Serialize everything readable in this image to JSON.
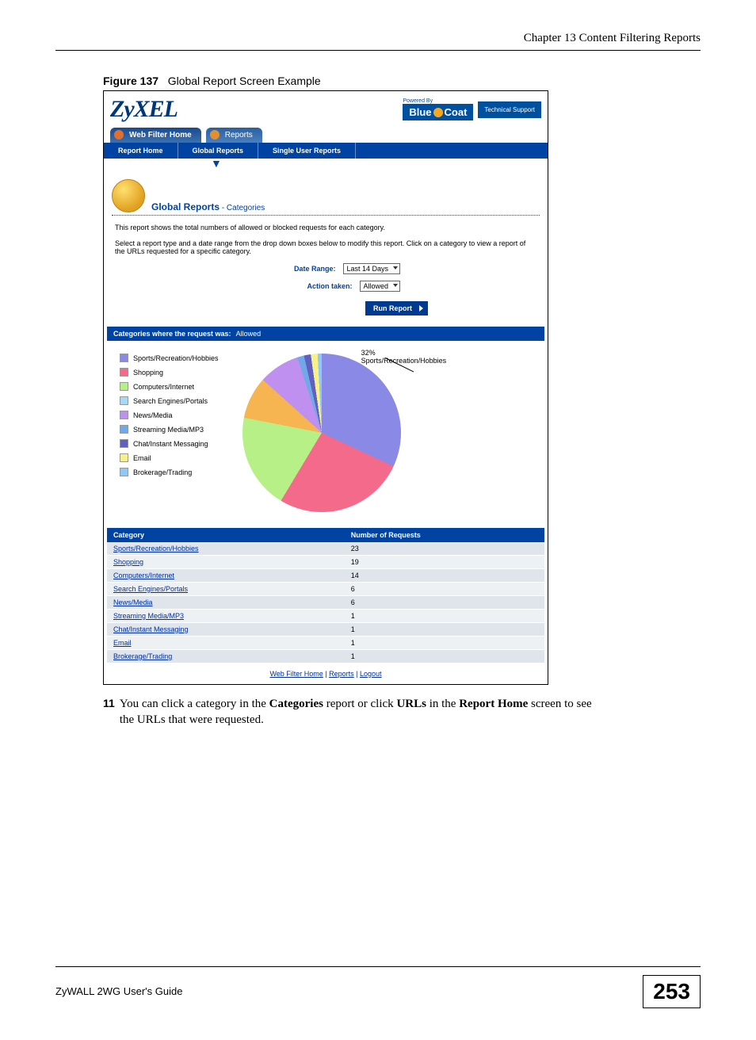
{
  "header": {
    "chapter": "Chapter 13 Content Filtering Reports"
  },
  "figure": {
    "label": "Figure 137",
    "title": "Global Report Screen Example"
  },
  "logo": {
    "text": "ZyXEL"
  },
  "powered_by": {
    "label": "Powered By",
    "brand_a": "Blue",
    "brand_b": "Coat",
    "tech_support": "Technical Support"
  },
  "tabs_primary": [
    {
      "label": "Web Filter Home",
      "active": true
    },
    {
      "label": "Reports",
      "active": false
    }
  ],
  "subnav": [
    {
      "label": "Report Home"
    },
    {
      "label": "Global Reports"
    },
    {
      "label": "Single User Reports"
    }
  ],
  "section": {
    "title": "Global Reports",
    "subtitle": "- Categories"
  },
  "description": {
    "line1": "This report shows the total numbers of allowed or blocked requests for each category.",
    "line2": "Select a report type and a date range from the drop down boxes below to modify this report. Click on a category to view a report of the URLs requested for a specific category."
  },
  "form": {
    "date_range_label": "Date Range:",
    "date_range_value": "Last 14 Days",
    "action_label": "Action taken:",
    "action_value": "Allowed",
    "run_button": "Run Report"
  },
  "cat_bar": {
    "label": "Categories where the request was:",
    "value": "Allowed"
  },
  "pie_caption": "32%  Sports/Recreation/Hobbies",
  "legend": [
    {
      "name": "Sports/Recreation/Hobbies",
      "color": "#8a8ae6"
    },
    {
      "name": "Shopping",
      "color": "#f46a8a"
    },
    {
      "name": "Computers/Internet",
      "color": "#b8f088"
    },
    {
      "name": "Search Engines/Portals",
      "color": "#a8d8f8"
    },
    {
      "name": "News/Media",
      "color": "#c090f0"
    },
    {
      "name": "Streaming Media/MP3",
      "color": "#70a8e8"
    },
    {
      "name": "Chat/Instant Messaging",
      "color": "#6060c0"
    },
    {
      "name": "Email",
      "color": "#f8f088"
    },
    {
      "name": "Brokerage/Trading",
      "color": "#90c8f8"
    }
  ],
  "table": {
    "headers": {
      "category": "Category",
      "requests": "Number of Requests"
    },
    "rows": [
      {
        "category": "Sports/Recreation/Hobbies",
        "requests": "23"
      },
      {
        "category": "Shopping",
        "requests": "19"
      },
      {
        "category": "Computers/Internet",
        "requests": "14"
      },
      {
        "category": "Search Engines/Portals",
        "requests": "6"
      },
      {
        "category": "News/Media",
        "requests": "6"
      },
      {
        "category": "Streaming Media/MP3",
        "requests": "1"
      },
      {
        "category": "Chat/Instant Messaging",
        "requests": "1"
      },
      {
        "category": "Email",
        "requests": "1"
      },
      {
        "category": "Brokerage/Trading",
        "requests": "1"
      }
    ]
  },
  "footer_links": {
    "a": "Web Filter Home",
    "sep1": " | ",
    "b": "Reports",
    "sep2": " | ",
    "c": "Logout"
  },
  "body_text": {
    "num": "11",
    "pre": "You can click a category in the ",
    "b1": "Categories",
    "mid1": " report or click ",
    "b2": "URLs",
    "mid2": " in the ",
    "b3": "Report Home",
    "post": " screen to see the URLs that were requested."
  },
  "page_footer": {
    "guide": "ZyWALL 2WG User's Guide",
    "page": "253"
  },
  "chart_data": {
    "type": "pie",
    "title": "Categories where the request was: Allowed",
    "series": [
      {
        "name": "Sports/Recreation/Hobbies",
        "value": 23,
        "percent": 32
      },
      {
        "name": "Shopping",
        "value": 19,
        "percent": 26
      },
      {
        "name": "Computers/Internet",
        "value": 14,
        "percent": 19
      },
      {
        "name": "Search Engines/Portals",
        "value": 6,
        "percent": 8
      },
      {
        "name": "News/Media",
        "value": 6,
        "percent": 8
      },
      {
        "name": "Streaming Media/MP3",
        "value": 1,
        "percent": 1
      },
      {
        "name": "Chat/Instant Messaging",
        "value": 1,
        "percent": 1
      },
      {
        "name": "Email",
        "value": 1,
        "percent": 1
      },
      {
        "name": "Brokerage/Trading",
        "value": 1,
        "percent": 1
      }
    ]
  }
}
